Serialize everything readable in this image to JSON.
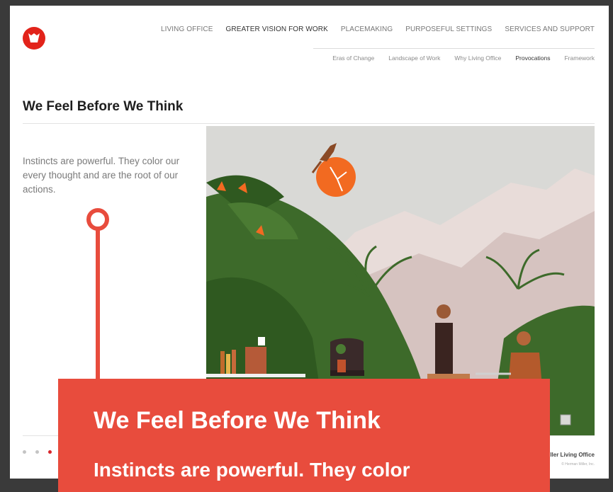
{
  "nav": {
    "items": [
      {
        "label": "LIVING OFFICE",
        "active": false
      },
      {
        "label": "GREATER VISION FOR WORK",
        "active": true
      },
      {
        "label": "PLACEMAKING",
        "active": false
      },
      {
        "label": "PURPOSEFUL SETTINGS",
        "active": false
      },
      {
        "label": "SERVICES AND SUPPORT",
        "active": false
      }
    ],
    "sub_items": [
      {
        "label": "Eras of Change",
        "active": false
      },
      {
        "label": "Landscape of Work",
        "active": false
      },
      {
        "label": "Why Living Office",
        "active": false
      },
      {
        "label": "Provocations",
        "active": true
      },
      {
        "label": "Framework",
        "active": false
      }
    ]
  },
  "page": {
    "title": "We Feel Before We Think",
    "intro": "Instincts are powerful. They color our every thought and are the root of our actions."
  },
  "slides": {
    "count": 7,
    "active_index": 3
  },
  "footer": {
    "brand": "Herman Miller Living Office",
    "copyright": "© Herman Miller, Inc."
  },
  "callout": {
    "title": "We Feel Before We Think",
    "text": "Instincts are powerful. They color"
  },
  "colors": {
    "accent": "#d8262c",
    "callout": "#e84c3d",
    "sky": "#d9d9d6",
    "foliage": "#3d6a2a",
    "sun": "#f26a21"
  }
}
